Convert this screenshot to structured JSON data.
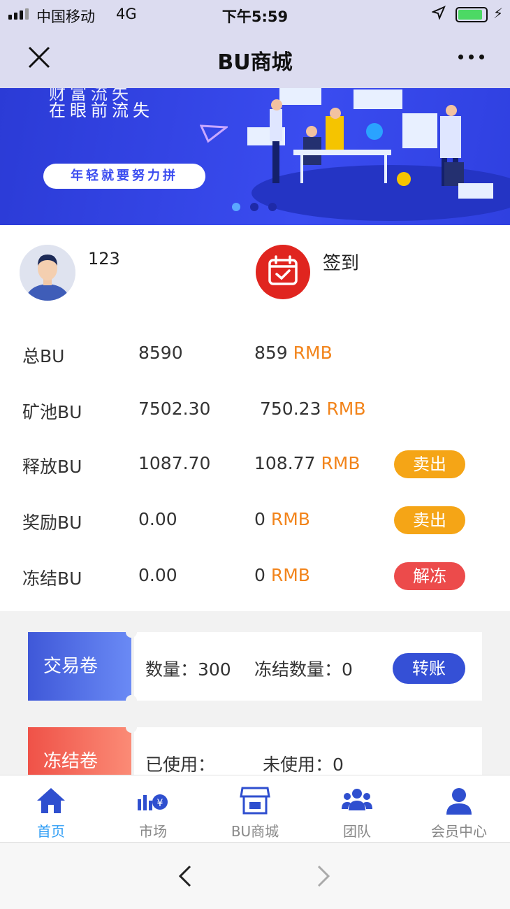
{
  "status_bar": {
    "carrier": "中国移动",
    "network": "4G",
    "time": "下午5:59",
    "battery_level": 0.9
  },
  "nav": {
    "title": "BU商城"
  },
  "banner": {
    "line1": "财富流失",
    "line2": "在眼前流失",
    "slogan": "年轻就要努力拼",
    "active_slide": 1,
    "slide_count": 3
  },
  "profile": {
    "username": "123",
    "sign_in_label": "签到"
  },
  "balances": [
    {
      "label": "总BU",
      "amount": "8590",
      "rmb": "859",
      "unit": "RMB",
      "action": ""
    },
    {
      "label": "矿池BU",
      "amount": "7502.30",
      "rmb": "750.23",
      "unit": "RMB",
      "action": ""
    },
    {
      "label": "释放BU",
      "amount": "1087.70",
      "rmb": "108.77",
      "unit": "RMB",
      "action": "卖出"
    },
    {
      "label": "奖励BU",
      "amount": "0.00",
      "rmb": "0",
      "unit": "RMB",
      "action": "卖出"
    },
    {
      "label": "冻结BU",
      "amount": "0.00",
      "rmb": "0",
      "unit": "RMB",
      "action": "解冻"
    }
  ],
  "tickets": [
    {
      "label": "交易卷",
      "text_a": "数量：300",
      "text_b": "冻结数量：0",
      "action": "转账"
    },
    {
      "label": "冻结卷",
      "text_a": "已使用：",
      "text_b": "未使用：0",
      "action": ""
    }
  ],
  "tabbar": [
    {
      "label": "首页",
      "icon": "home-icon",
      "active": true
    },
    {
      "label": "市场",
      "icon": "market-icon",
      "active": false
    },
    {
      "label": "BU商城",
      "icon": "shop-icon",
      "active": false
    },
    {
      "label": "团队",
      "icon": "team-icon",
      "active": false
    },
    {
      "label": "会员中心",
      "icon": "member-icon",
      "active": false
    }
  ],
  "colors": {
    "accent_orange": "#f5a516",
    "accent_red": "#ec4b4b",
    "accent_blue": "#3550d6",
    "tab_active": "#2e9df5"
  }
}
